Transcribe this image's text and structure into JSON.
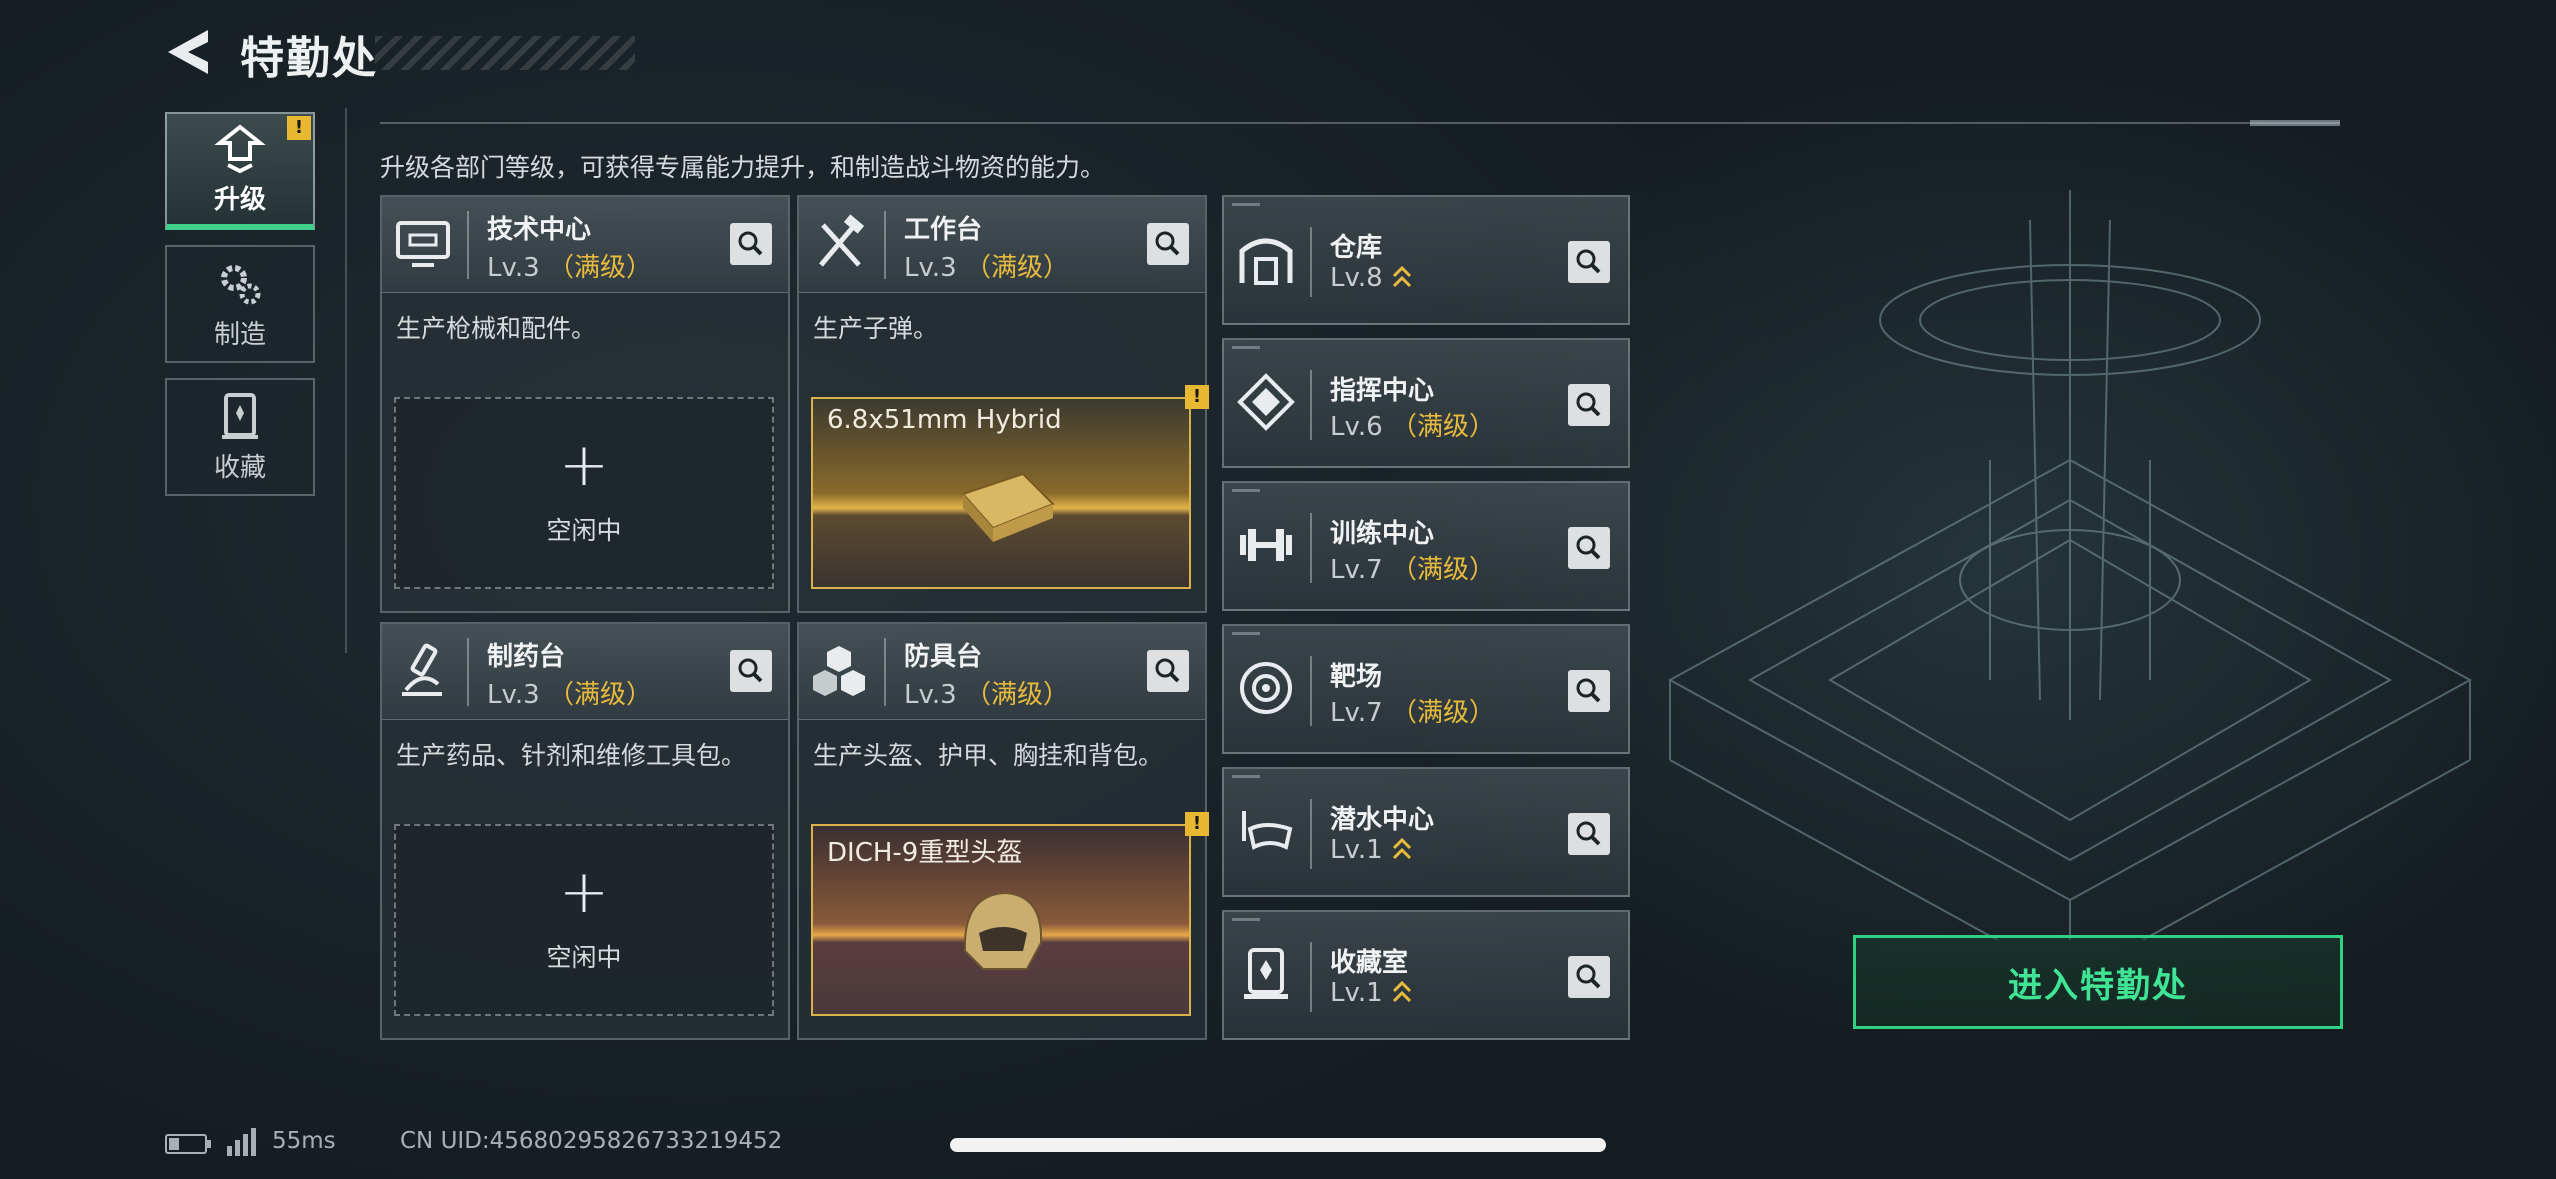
{
  "header": {
    "title": "特勤处"
  },
  "nav": {
    "items": [
      {
        "label": "升级",
        "icon": "upgrade-icon",
        "active": true,
        "alert": "!"
      },
      {
        "label": "制造",
        "icon": "gears-icon",
        "active": false
      },
      {
        "label": "收藏",
        "icon": "collection-icon",
        "active": false
      }
    ]
  },
  "description": "升级各部门等级，可获得专属能力提升，和制造战斗物资的能力。",
  "cards": [
    {
      "name": "技术中心",
      "level": "Lv.3",
      "status": "（满级）",
      "desc": "生产枪械和配件。",
      "icon": "computer-icon",
      "slot": {
        "type": "idle",
        "plus": "+",
        "label": "空闲中"
      }
    },
    {
      "name": "工作台",
      "level": "Lv.3",
      "status": "（满级）",
      "desc": "生产子弹。",
      "icon": "tools-icon",
      "slot": {
        "type": "product",
        "label": "6.8x51mm Hybrid",
        "alert": "!"
      }
    },
    {
      "name": "制药台",
      "level": "Lv.3",
      "status": "（满级）",
      "desc": "生产药品、针剂和维修工具包。",
      "icon": "microscope-icon",
      "slot": {
        "type": "idle",
        "plus": "+",
        "label": "空闲中"
      }
    },
    {
      "name": "防具台",
      "level": "Lv.3",
      "status": "（满级）",
      "desc": "生产头盔、护甲、胸挂和背包。",
      "icon": "armor-icon",
      "slot": {
        "type": "product",
        "label": "DICH-9重型头盔",
        "alert": "!"
      }
    }
  ],
  "facilities": [
    {
      "name": "仓库",
      "level": "Lv.8",
      "status": "",
      "upgradable": true,
      "icon": "warehouse-icon"
    },
    {
      "name": "指挥中心",
      "level": "Lv.6",
      "status": "（满级）",
      "upgradable": false,
      "icon": "command-icon"
    },
    {
      "name": "训练中心",
      "level": "Lv.7",
      "status": "（满级）",
      "upgradable": false,
      "icon": "dumbbell-icon"
    },
    {
      "name": "靶场",
      "level": "Lv.7",
      "status": "（满级）",
      "upgradable": false,
      "icon": "target-icon"
    },
    {
      "name": "潜水中心",
      "level": "Lv.1",
      "status": "",
      "upgradable": true,
      "icon": "diving-mask-icon"
    },
    {
      "name": "收藏室",
      "level": "Lv.1",
      "status": "",
      "upgradable": true,
      "icon": "trophy-case-icon"
    }
  ],
  "enter_button": "进入特勤处",
  "status_bar": {
    "ping": "55ms",
    "uid": "CN UID:4568029582673321945​2"
  },
  "colors": {
    "accent_green": "#3fe495",
    "max_level_gold": "#e8bb3c",
    "alert_yellow": "#e9b833"
  }
}
